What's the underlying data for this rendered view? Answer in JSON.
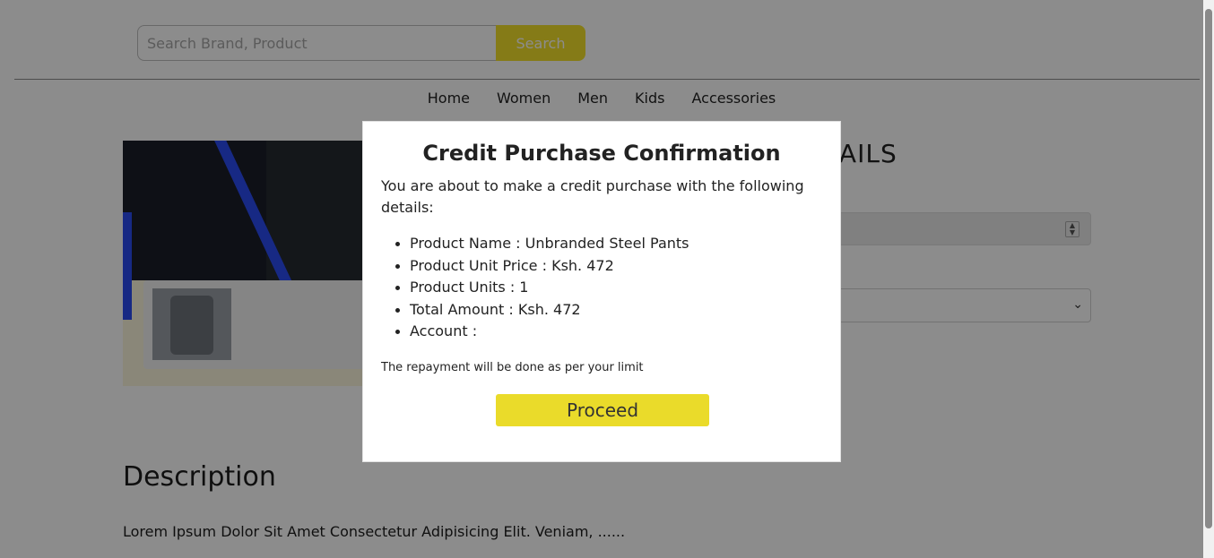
{
  "header": {
    "search_placeholder": "Search Brand, Product",
    "search_button": "Search",
    "nav": [
      "Home",
      "Women",
      "Men",
      "Kids",
      "Accessories"
    ]
  },
  "product": {
    "details_heading": "TAILS"
  },
  "description": {
    "title": "Description",
    "text": "Lorem Ipsum Dolor Sit Amet Consectetur Adipisicing Elit. Veniam, ......"
  },
  "modal": {
    "title": "Credit Purchase Confirmation",
    "intro": "You are about to make a credit purchase with the following details:",
    "details": [
      "Product Name : Unbranded Steel Pants",
      "Product Unit Price : Ksh. 472",
      "Product Units : 1",
      "Total Amount : Ksh. 472",
      "Account :"
    ],
    "note": "The repayment will be done as per your limit",
    "proceed": "Proceed"
  }
}
